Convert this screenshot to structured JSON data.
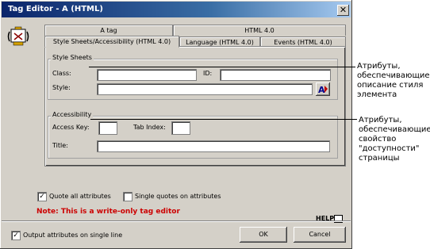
{
  "window": {
    "title": "Tag Editor - A  (HTML)",
    "close_glyph": "✕"
  },
  "tabs_back": [
    {
      "label": "A tag"
    },
    {
      "label": "HTML 4.0"
    }
  ],
  "tabs_front": [
    {
      "label": "Style Sheets/Accessibility (HTML 4.0)",
      "active": true
    },
    {
      "label": "Language (HTML 4.0)",
      "active": false
    },
    {
      "label": "Events (HTML 4.0)",
      "active": false
    }
  ],
  "style_sheets": {
    "group_label": "Style Sheets",
    "class_label": "Class:",
    "id_label": "ID:",
    "style_label": "Style:",
    "class_value": "",
    "id_value": "",
    "style_value": ""
  },
  "accessibility": {
    "group_label": "Accessibility",
    "access_key_label": "Access Key:",
    "tab_index_label": "Tab Index:",
    "title_label": "Title:",
    "access_key_value": "",
    "tab_index_value": "",
    "title_value": ""
  },
  "options": {
    "quote_all_label": "Quote all attributes",
    "quote_all_checked": true,
    "single_quotes_label": "Single quotes on attributes",
    "single_quotes_checked": false,
    "output_single_line_label": "Output attributes on single line",
    "output_single_line_checked": true
  },
  "note": "Note: This is a write-only tag editor",
  "help_text": "HELP",
  "buttons": {
    "ok": "OK",
    "cancel": "Cancel"
  },
  "annotations": {
    "style_lines": [
      "Атрибуты,",
      "обеспечивающие",
      "описание стиля",
      "элемента"
    ],
    "access_lines": [
      "Атрибуты,",
      "обеспечивающие",
      "свойство",
      "\"доступности\"",
      "страницы"
    ]
  }
}
